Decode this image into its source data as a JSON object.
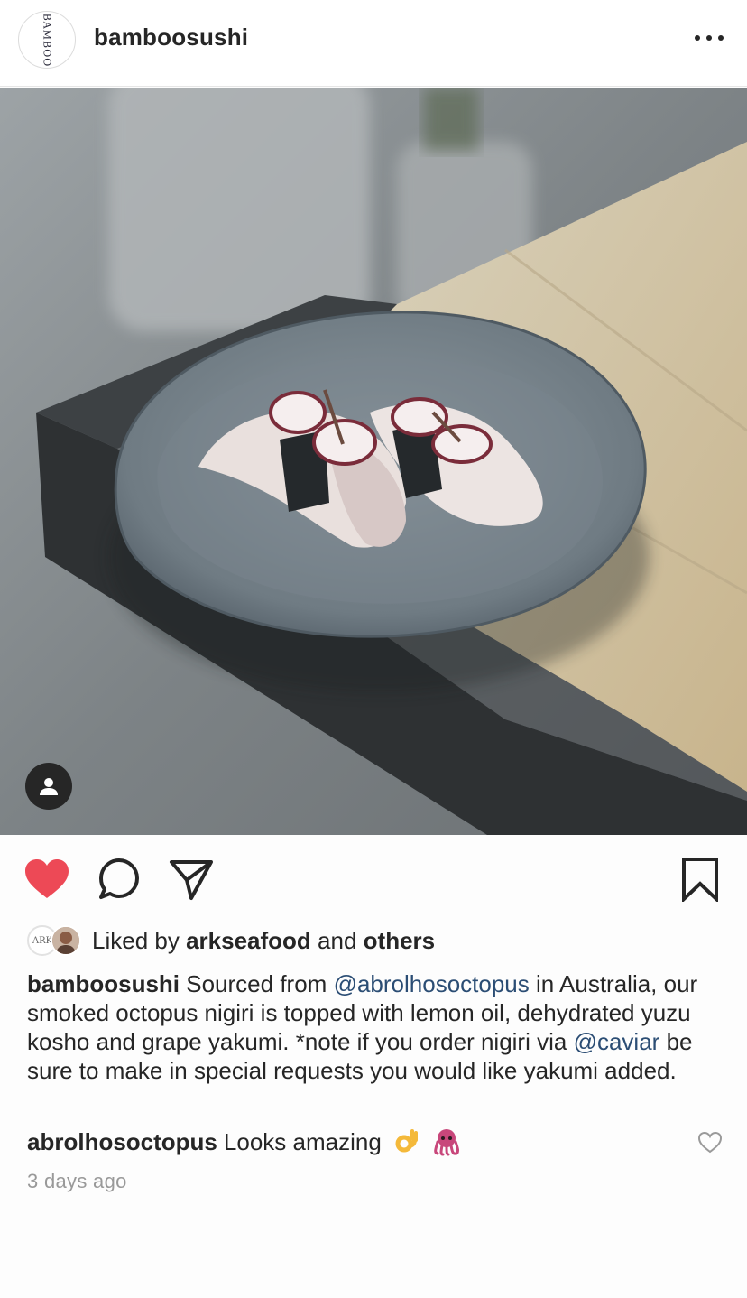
{
  "header": {
    "username": "bamboosushi",
    "avatar_text": "BAMBOO"
  },
  "photo": {
    "icon": "person-icon"
  },
  "actions": {
    "like_icon": "heart-filled-icon",
    "comment_icon": "comment-bubble-icon",
    "share_icon": "paper-plane-icon",
    "save_icon": "bookmark-icon",
    "like_color": "#ed4956"
  },
  "likes": {
    "prefix": "Liked by",
    "user": "arkseafood",
    "connector": "and",
    "others": "others",
    "avatar1_text": "ARK"
  },
  "caption": {
    "username": "bamboosushi",
    "part1": "Sourced from",
    "mention1": "@abrolhosoctopus",
    "part2": "in Australia, our smoked octopus nigiri is topped with lemon oil, dehydrated yuzu kosho and grape yakumi. *note if you order nigiri via",
    "mention2": "@caviar",
    "part3": "be sure to make in special requests you would like yakumi added."
  },
  "comment": {
    "username": "abrolhosoctopus",
    "text": "Looks amazing",
    "emojis": [
      "ok-hand-emoji",
      "octopus-emoji"
    ]
  },
  "timestamp": "3 days ago",
  "colors": {
    "mention": "#2b4d74",
    "timestamp": "#999999",
    "heart": "#ed4956"
  }
}
